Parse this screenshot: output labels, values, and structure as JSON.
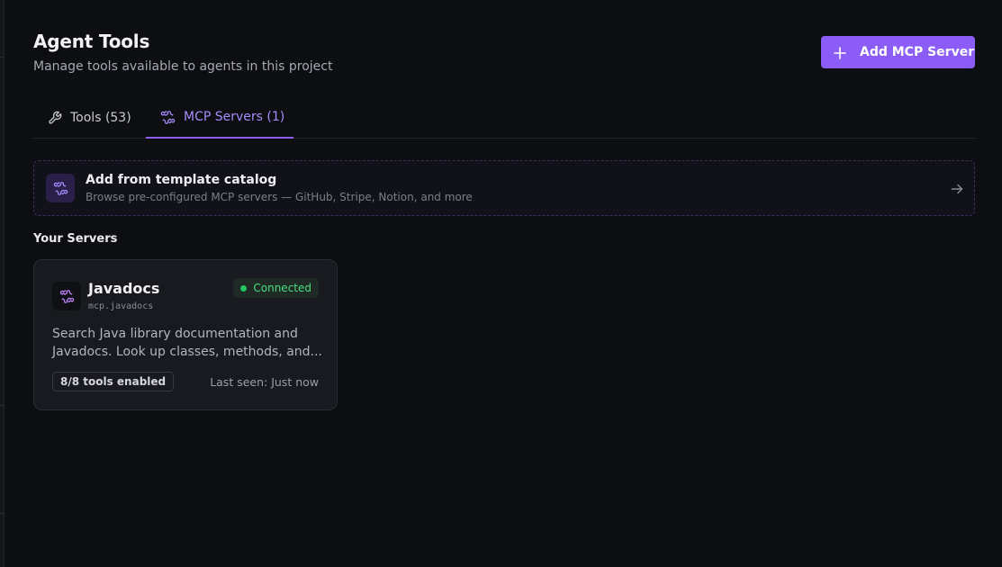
{
  "header": {
    "title": "Agent Tools",
    "subtitle": "Manage tools available to agents in this project",
    "add_button_label": "Add MCP Server"
  },
  "tabs": [
    {
      "label": "Tools (53)",
      "icon": "wrench-icon",
      "active": false
    },
    {
      "label": "MCP Servers (1)",
      "icon": "puzzle-icon",
      "active": true
    }
  ],
  "catalog": {
    "title": "Add from template catalog",
    "description": "Browse pre-configured MCP servers — GitHub, Stripe, Notion, and more"
  },
  "servers_section": {
    "title": "Your Servers",
    "servers": [
      {
        "name": "Javadocs",
        "id": "mcp.javadocs",
        "status": "Connected",
        "description": "Search Java library documentation and Javadocs. Look up classes, methods, and...",
        "tools_enabled": "8/8 tools enabled",
        "last_seen": "Last seen: Just now"
      }
    ]
  },
  "colors": {
    "accent": "#8b5cf6",
    "accent_text": "#a78bfa",
    "status_connected": "#22c55e",
    "background": "#0d0e12"
  }
}
